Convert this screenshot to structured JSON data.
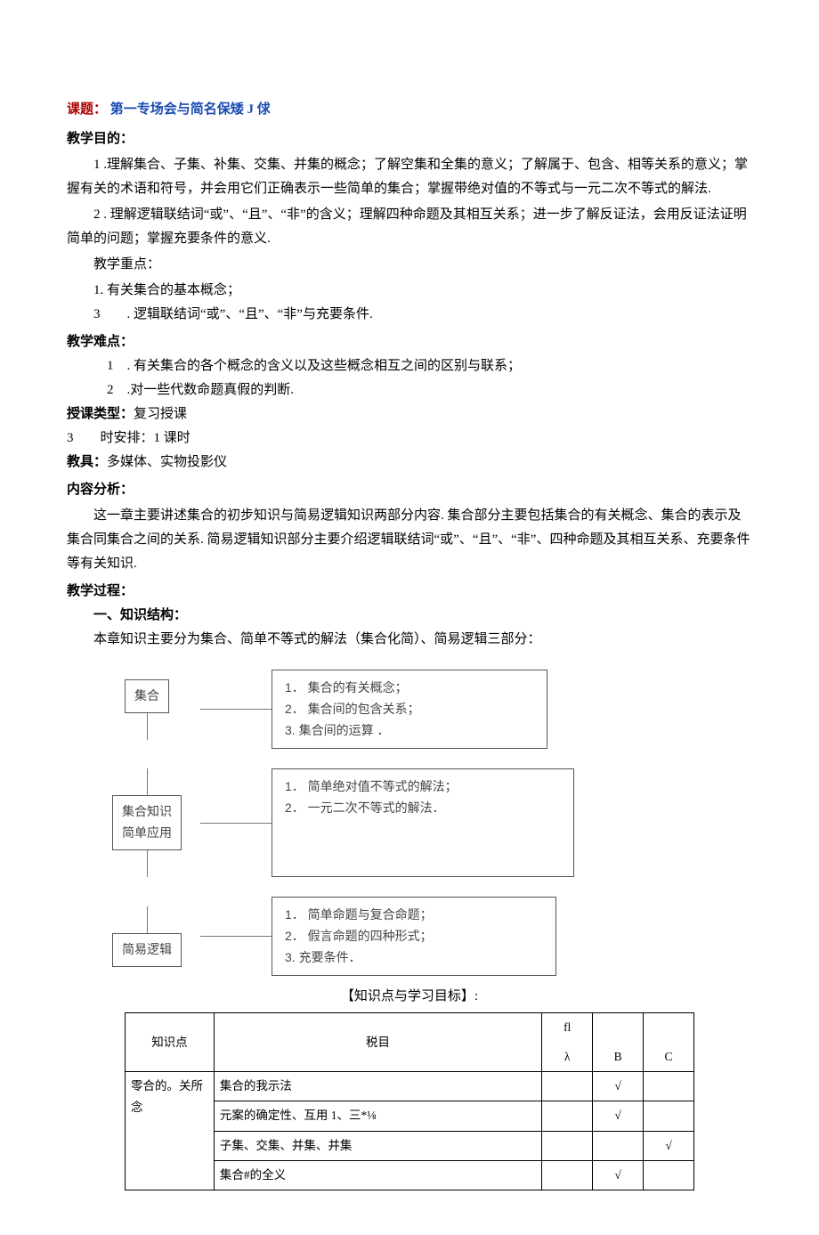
{
  "title": {
    "label": "课题：",
    "text": "第一专场会与简名保矮 J 俅"
  },
  "sec_purpose": "教学目的：",
  "p1": "1 .理解集合、子集、补集、交集、并集的概念；了解空集和全集的意义；了解属于、包含、相等关系的意义；掌握有关的术语和符号，并会用它们正确表示一些简单的集合；掌握带绝对值的不等式与一元二次不等式的解法.",
  "p2": "2 . 理解逻辑联结词“或”、“且”、“非”的含义；理解四种命题及其相互关系；进一步了解反证法，会用反证法证明简单的问题；掌握充要条件的意义.",
  "focus_head": "教学重点：",
  "focus1": "1. 有关集合的基本概念；",
  "focus2": "3　　. 逻辑联结词“或”、“且”、“非”与充要条件.",
  "sec_difficulty": "教学难点：",
  "d1": "1　. 有关集合的各个概念的含义以及这些概念相互之间的区别与联系；",
  "d2": "2　.对一些代数命题真假的判断.",
  "sec_type_label": "授课类型：",
  "sec_type_value": "复习授课",
  "sec_time": "3　　时安排：",
  "sec_time_value": "1 课时",
  "sec_tool_label": "教具：",
  "sec_tool_value": "多媒体、实物投影仪",
  "sec_content": "内容分析：",
  "content_p": "这一章主要讲述集合的初步知识与简易逻辑知识两部分内容. 集合部分主要包括集合的有关概念、集合的表示及集合同集合之间的关系. 简易逻辑知识部分主要介绍逻辑联结词“或”、“且”、“非”、四种命题及其相互关系、充要条件等有关知识.",
  "sec_process": "教学过程：",
  "struct_head": "一、知识结构：",
  "struct_p": "本章知识主要分为集合、简单不等式的解法（集合化简）、简易逻辑三部分：",
  "diagram": {
    "b1_left": "集合",
    "b1_right": "1．  集合的有关概念；\n2．  集合间的包含关系；\n3.   集合间的运算 ．",
    "b2_left": "集合知识\n简单应用",
    "b2_right": "1．  简单绝对值不等式的解法；\n2．  一元二次不等式的解法．",
    "b3_left": "简易逻辑",
    "b3_right": "1．  简单命题与复合命题；\n2．  假言命题的四种形式；\n3.   充要条件．"
  },
  "caption": "【知识点与学习目标】:",
  "table": {
    "headers": [
      "知识点",
      "税目",
      "fl",
      "",
      ""
    ],
    "sub_headers": [
      "λ",
      "B",
      "C"
    ],
    "group": "零合的。关所念",
    "rows": [
      {
        "item": "集合的我示法",
        "a": "",
        "b": "√",
        "c": ""
      },
      {
        "item": "元案的确定性、互用 1、三*⅛",
        "a": "",
        "b": "√",
        "c": ""
      },
      {
        "item": "子集、交集、并集、并集",
        "a": "",
        "b": "",
        "c": "√"
      },
      {
        "item": "集合#的全义",
        "a": "",
        "b": "√",
        "c": ""
      }
    ]
  }
}
